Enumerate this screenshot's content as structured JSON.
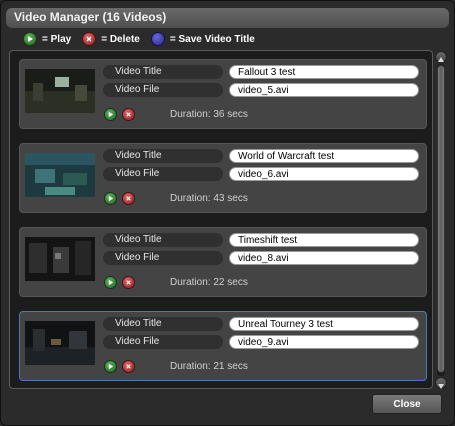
{
  "window": {
    "title": "Video Manager (16 Videos)",
    "close_label": "Close"
  },
  "legend": {
    "play": "= Play",
    "delete": "= Delete",
    "save": "= Save Video Title"
  },
  "fields": {
    "title_label": "Video Title",
    "file_label": "Video File"
  },
  "videos": [
    {
      "title": "Fallout 3 test",
      "file": "video_5.avi",
      "duration": "Duration: 36 secs"
    },
    {
      "title": "World of Warcraft test",
      "file": "video_6.avi",
      "duration": "Duration: 43 secs"
    },
    {
      "title": "Timeshift test",
      "file": "video_8.avi",
      "duration": "Duration: 22 secs"
    },
    {
      "title": "Unreal Tourney 3 test",
      "file": "video_9.avi",
      "duration": "Duration: 21 secs"
    }
  ],
  "colors": {
    "play": "#3f8f3f",
    "delete": "#b83a3a",
    "save": "#3c3cb0",
    "selected_border": "#4a78b8"
  }
}
